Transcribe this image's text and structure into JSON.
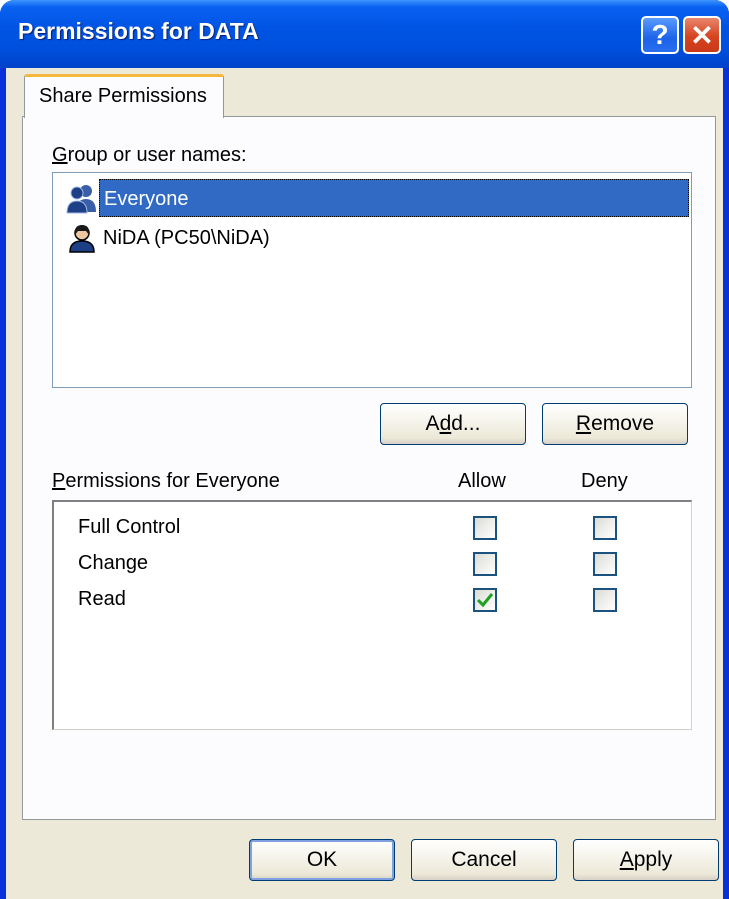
{
  "window": {
    "title": "Permissions for DATA",
    "help_glyph": "?",
    "close_glyph": "✕"
  },
  "tabs": [
    {
      "label": "Share Permissions",
      "active": true
    }
  ],
  "group_label": {
    "mnemonic": "G",
    "rest": "roup or user names:"
  },
  "users": [
    {
      "name": "Everyone",
      "icon": "group-users-icon",
      "selected": true
    },
    {
      "name": "NiDA (PC50\\NiDA)",
      "icon": "user-icon",
      "selected": false
    }
  ],
  "buttons_mid": {
    "add": {
      "pre": "A",
      "mnemonic": "d",
      "post": "d..."
    },
    "remove": {
      "mnemonic": "R",
      "post": "emove"
    }
  },
  "permissions_header": {
    "mnemonic": "P",
    "rest": "ermissions for Everyone",
    "allow": "Allow",
    "deny": "Deny"
  },
  "permissions": [
    {
      "name": "Full Control",
      "allow": false,
      "deny": false
    },
    {
      "name": "Change",
      "allow": false,
      "deny": false
    },
    {
      "name": "Read",
      "allow": true,
      "deny": false
    }
  ],
  "footer": {
    "ok": "OK",
    "cancel": "Cancel",
    "apply": {
      "mnemonic": "A",
      "post": "pply"
    }
  },
  "colors": {
    "titlebar": "#0054e3",
    "selection": "#316ac5",
    "tab_accent": "#f6b73e",
    "dialog_bg": "#ece9d8",
    "checkmark": "#21a121"
  }
}
